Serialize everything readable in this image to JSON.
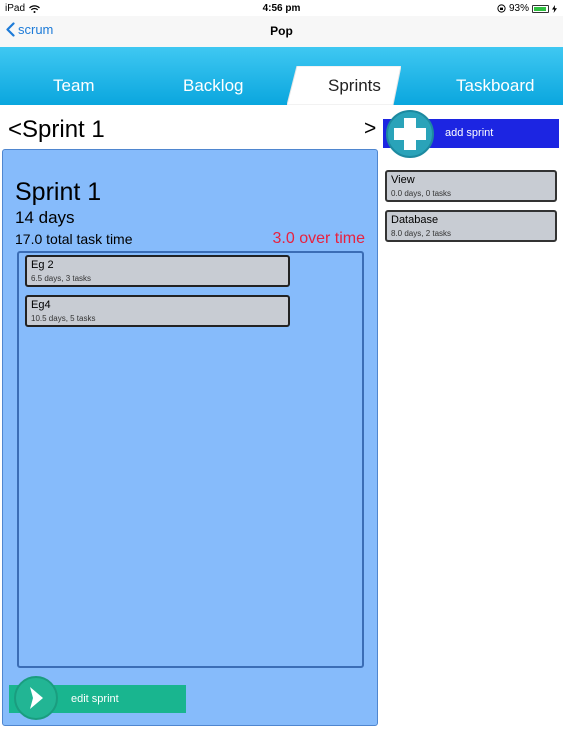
{
  "status_bar": {
    "device": "iPad",
    "time": "4:56 pm",
    "battery": "93%",
    "battery_level": 0.93
  },
  "nav": {
    "back_label": "scrum",
    "title": "Pop"
  },
  "tabs": [
    {
      "label": "Team"
    },
    {
      "label": "Backlog"
    },
    {
      "label": "Sprints",
      "active": true
    },
    {
      "label": "Taskboard"
    }
  ],
  "sprint_header": {
    "prev_label": "<Sprint 1",
    "next_label": ">",
    "add_label": "add sprint"
  },
  "sprint": {
    "name": "Sprint 1",
    "duration": "14 days",
    "total_time": "17.0 total task time",
    "over_time": "3.0 over time",
    "edit_label": "edit sprint",
    "stories": [
      {
        "title": "Eg 2",
        "subtitle": "6.5 days, 3 tasks"
      },
      {
        "title": "Eg4",
        "subtitle": "10.5 days, 5 tasks"
      }
    ]
  },
  "available_stories": [
    {
      "title": "View",
      "subtitle": "0.0 days, 0 tasks"
    },
    {
      "title": "Database",
      "subtitle": "8.0 days, 2 tasks"
    }
  ],
  "colors": {
    "tab_bar": "#0aa6de",
    "sprint_panel": "#86bbfb",
    "add_button": "#1c25e2",
    "edit_button": "#19b58f",
    "over_time": "#e8213f"
  }
}
